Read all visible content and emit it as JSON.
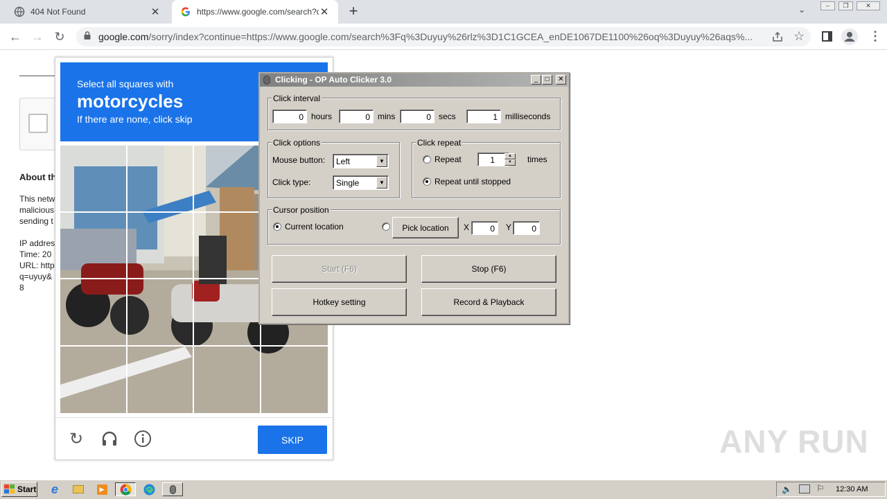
{
  "browser": {
    "tabs": [
      {
        "title": "404 Not Found",
        "icon": "globe-icon"
      },
      {
        "title": "https://www.google.com/search?q=",
        "icon": "google-icon",
        "active": true
      }
    ],
    "new_tab_symbol": "+",
    "address": {
      "domain": "google.com",
      "path": "/sorry/index?continue=https://www.google.com/search%3Fq%3Duyuy%26rlz%3D1C1GCEA_enDE1067DE1100%26oq%3Duyuy%26aqs%..."
    },
    "window_controls": [
      "minimize-icon",
      "restore-icon",
      "close-icon"
    ]
  },
  "page": {
    "heading_partial": "About th",
    "body_lines": [
      "This netw",
      "malicious",
      "sending t"
    ],
    "info_lines": [
      "IP addres",
      "Time: 20",
      "URL: http",
      "q=uyuy&",
      "8"
    ]
  },
  "captcha": {
    "instruction_line1": "Select all squares with",
    "target": "motorcycles",
    "instruction_line3": "If there are none, click skip",
    "skip_label": "SKIP",
    "footer_icons": [
      "reload-icon",
      "audio-icon",
      "info-icon"
    ]
  },
  "autoclicker": {
    "title": "Clicking - OP Auto Clicker 3.0",
    "click_interval": {
      "label": "Click interval",
      "hours": "0",
      "hours_label": "hours",
      "mins": "0",
      "mins_label": "mins",
      "secs": "0",
      "secs_label": "secs",
      "ms": "1",
      "ms_label": "milliseconds"
    },
    "click_options": {
      "label": "Click options",
      "mouse_button_label": "Mouse button:",
      "mouse_button": "Left",
      "click_type_label": "Click type:",
      "click_type": "Single"
    },
    "click_repeat": {
      "label": "Click repeat",
      "repeat_label": "Repeat",
      "repeat_count": "1",
      "times_label": "times",
      "until_stopped_label": "Repeat until stopped",
      "selected": "until_stopped"
    },
    "cursor_position": {
      "label": "Cursor position",
      "current_label": "Current location",
      "pick_label": "Pick location",
      "x_label": "X",
      "x": "0",
      "y_label": "Y",
      "y": "0",
      "selected": "current"
    },
    "buttons": {
      "start": "Start (F6)",
      "stop": "Stop (F6)",
      "hotkey": "Hotkey setting",
      "record": "Record & Playback"
    }
  },
  "taskbar": {
    "start_label": "Start",
    "apps": [
      "ie-icon",
      "folder-icon",
      "media-player-icon",
      "chrome-icon",
      "edge-icon",
      "autoclicker-icon"
    ],
    "clock": "12:30 AM"
  },
  "watermark": "ANY RUN"
}
